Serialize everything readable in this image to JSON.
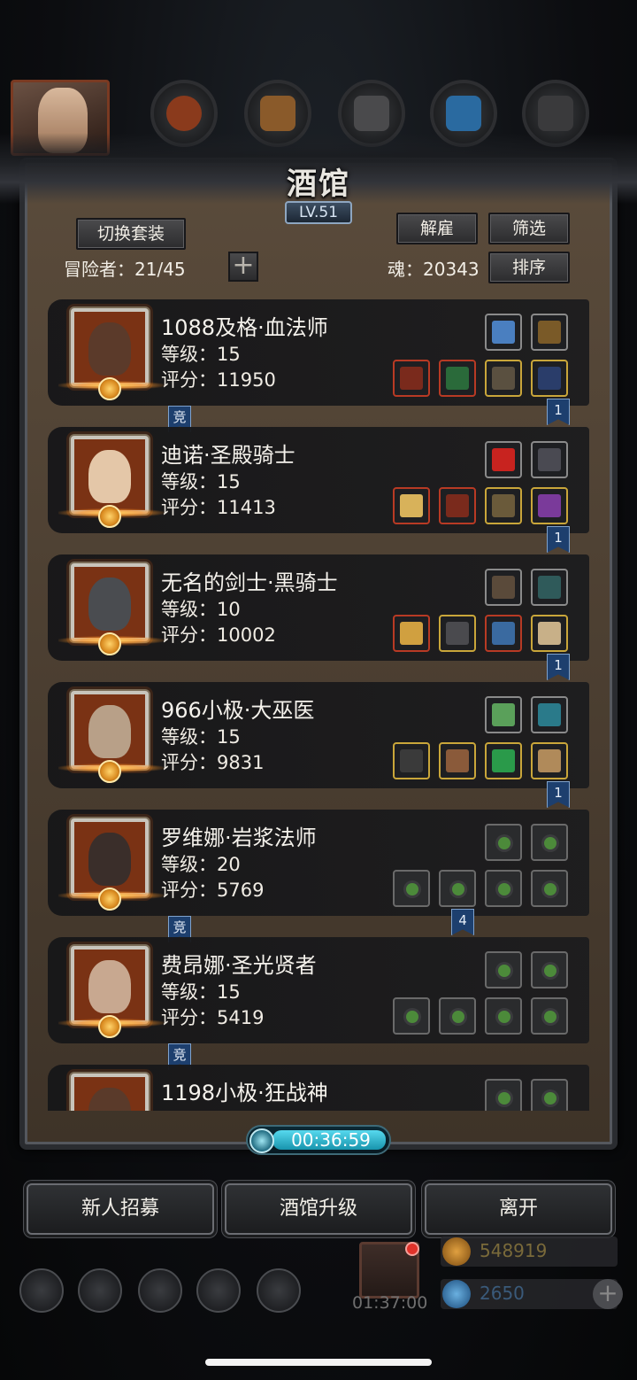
{
  "title": "酒馆",
  "level_badge": "LV.51",
  "header": {
    "switch_outfit": "切换套装",
    "dismiss": "解雇",
    "filter": "筛选",
    "sort": "排序",
    "adventurers_label": "冒险者：",
    "adventurers_value": "21/45",
    "soul_label": "魂：",
    "soul_value": "20343",
    "plus": "+"
  },
  "heroes": [
    {
      "name": "1088及格·血法师",
      "level_label": "等级：",
      "level": "15",
      "score_label": "评分：",
      "score": "11950",
      "tag_left": "竞",
      "tag_right": "1",
      "face": "#5b3a2a",
      "slots_top": [
        "#4a7fc0",
        "#7a5a28"
      ],
      "slots_bottom": [
        "#7a2a1c",
        "#2a6a3a",
        "#5a5040",
        "#2a3d6a"
      ],
      "slot_border_top": [
        "empty-gray",
        "gray"
      ],
      "slot_border_bottom": [
        "red",
        "red",
        "gold",
        "gold"
      ]
    },
    {
      "name": "迪诺·圣殿骑士",
      "level_label": "等级：",
      "level": "15",
      "score_label": "评分：",
      "score": "11413",
      "tag_left": "",
      "tag_right": "1",
      "face": "#e4c7a8",
      "slots_top": [
        "#c8231f",
        "#4a4a52"
      ],
      "slots_bottom": [
        "#d8b25a",
        "#7a2a1c",
        "#6a5a3a",
        "#7a3a9a"
      ],
      "slot_border_top": [
        "gray",
        "gray"
      ],
      "slot_border_bottom": [
        "red",
        "red",
        "gold",
        "gold"
      ]
    },
    {
      "name": "无名的剑士·黑骑士",
      "level_label": "等级：",
      "level": "10",
      "score_label": "评分：",
      "score": "10002",
      "tag_left": "",
      "tag_right": "1",
      "face": "#4a4c50",
      "slots_top": [
        "#5a4a3a",
        "#2f5a5a"
      ],
      "slots_bottom": [
        "#d0a040",
        "#4a4a4e",
        "#3a6aa0",
        "#c8b088"
      ],
      "slot_border_top": [
        "gray",
        "gray"
      ],
      "slot_border_bottom": [
        "red",
        "gold",
        "red",
        "gold"
      ]
    },
    {
      "name": "966小极·大巫医",
      "level_label": "等级：",
      "level": "15",
      "score_label": "评分：",
      "score": "9831",
      "tag_left": "",
      "tag_right": "1",
      "face": "#b8a088",
      "slots_top": [
        "#5aa05a",
        "#2a7a8a"
      ],
      "slots_bottom": [
        "#3a3a3a",
        "#8a5a3a",
        "#2a9a4a",
        "#b08a5a"
      ],
      "slot_border_top": [
        "gray",
        "gray"
      ],
      "slot_border_bottom": [
        "gold",
        "gold",
        "gold",
        "gold"
      ]
    },
    {
      "name": "罗维娜·岩浆法师",
      "level_label": "等级：",
      "level": "20",
      "score_label": "评分：",
      "score": "5769",
      "tag_left": "竞",
      "tag_right": "4",
      "face": "#3a2e2a",
      "slots_top": [
        "",
        ""
      ],
      "slots_bottom": [
        "",
        "",
        "",
        ""
      ],
      "slot_border_top": [
        "empty",
        "empty"
      ],
      "slot_border_bottom": [
        "empty",
        "empty",
        "empty",
        "empty"
      ]
    },
    {
      "name": "费昂娜·圣光贤者",
      "level_label": "等级：",
      "level": "15",
      "score_label": "评分：",
      "score": "5419",
      "tag_left": "竞",
      "tag_right": "",
      "face": "#c8a890",
      "slots_top": [
        "",
        ""
      ],
      "slots_bottom": [
        "",
        "",
        "",
        ""
      ],
      "slot_border_top": [
        "empty",
        "empty"
      ],
      "slot_border_bottom": [
        "empty",
        "empty",
        "empty",
        "empty"
      ]
    },
    {
      "name": "1198小极·狂战神",
      "level_label": "等级：",
      "level": "",
      "score_label": "评分：",
      "score": "",
      "tag_left": "",
      "tag_right": "",
      "face": "#5a3a2a",
      "slots_top": [
        "",
        ""
      ],
      "slots_bottom": [],
      "slot_border_top": [
        "empty",
        "empty"
      ],
      "slot_border_bottom": []
    }
  ],
  "timer": "00:36:59",
  "bottom_buttons": {
    "recruit": "新人招募",
    "upgrade": "酒馆升级",
    "leave": "离开"
  },
  "resources": {
    "gold": "548919",
    "gem": "2650",
    "gift_timer": "01:37:00"
  },
  "colors": {
    "gold_text": "#7a6a3a",
    "gem_text": "#3a5a7a",
    "accent_blue": "#57d9ee"
  },
  "icons": {
    "top_bar": [
      "portrait",
      "meat-icon",
      "wood-icon",
      "iron-icon",
      "crystal-icon",
      "ore-icon"
    ],
    "bottom_bar": [
      "settings-icon",
      "achievement-icon",
      "tavern-icon",
      "mail-icon",
      "shop-icon"
    ]
  }
}
